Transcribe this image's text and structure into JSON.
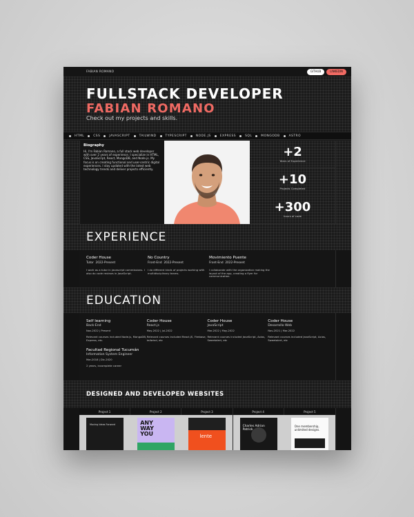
{
  "topbar": {
    "brand": "FABIAN ROMANO",
    "github_label": "GITHUB",
    "linkedin_label": "LINKEDIN"
  },
  "hero": {
    "title": "FULLSTACK DEVELOPER",
    "name": "FABIAN ROMANO",
    "subtitle": "Check out my projects and skills."
  },
  "tech": [
    "HTML",
    "CSS",
    "JAVASCRIPT",
    "TAILWIND",
    "TYPESCRIPT",
    "NODE.JS",
    "EXPRESS",
    "SQL",
    "MONGODB",
    "ASTRO"
  ],
  "bio": {
    "heading": "Biography",
    "text": "Hi, I'm Fabian Romano, a full stack web developer with over 2 years of experience. I specialize in HTML, CSS, JavaScript, React, MongoDB, and Node.js. My focus is on creating functional and user-centric digital experiences. I stay updated with the latest web technology trends and deliver projects efficiently."
  },
  "stats": [
    {
      "value": "+2",
      "label": "Years of Experience"
    },
    {
      "value": "+10",
      "label": "Projects Completed"
    },
    {
      "value": "+300",
      "label": "hours of code"
    }
  ],
  "experience": {
    "title": "EXPERIENCE",
    "items": [
      {
        "company": "Coder House",
        "role": "Tutor",
        "period": "2022-Present",
        "desc": "I work as a tutor in javascript commissions. I also do code reviews in JavaScript."
      },
      {
        "company": "No Country",
        "role": "Front-End",
        "period": "2022-Present",
        "desc": "I do different kinds of projects working with multidisciplinary teams."
      },
      {
        "company": "Movimiento Puente",
        "role": "Front-End",
        "period": "2022-Present",
        "desc": "I collaborate with the organization making the layout of the app, creating a flyer for communication."
      }
    ]
  },
  "education": {
    "title": "EDUCATION",
    "items": [
      {
        "school": "Self learning",
        "degree": "Back-End",
        "dates": "Nov-2022 | Present",
        "related": "Relevant courses included Node.js, MongoDB, Express, etc."
      },
      {
        "school": "Coder House",
        "degree": "React.js",
        "dates": "May-2022 | Jul-2022",
        "related": "Relevant courses included React.JS, Firebase, tailwind, etc"
      },
      {
        "school": "Coder House",
        "degree": "JavaScript",
        "dates": "Mar-2022 | May-2022",
        "related": "Relevant courses included JavaScript, Axios, Sweetalert, etc"
      },
      {
        "school": "Coder House",
        "degree": "Desarrollo Web",
        "dates": "Nov-2021 | Mar-2022",
        "related": "Relevant courses included JavaScript, Axios, Sweetalert, etc"
      },
      {
        "school": "Facultad Regional Tucumán",
        "degree": "Information System Engineer",
        "dates": "Mar-2018 | Dic-2020",
        "related": "2 years, incomplete career"
      }
    ]
  },
  "projects": {
    "title": "DESIGNED AND DEVELOPED WEBSITES",
    "items": [
      {
        "label": "Project 1",
        "thumb_text": "Moving Ideas Forward"
      },
      {
        "label": "Project 2",
        "thumb_text": "ANY WAY YOU"
      },
      {
        "label": "Project 3",
        "thumb_text": "lente"
      },
      {
        "label": "Project 4",
        "thumb_text": "Charles Adrian Patrick"
      },
      {
        "label": "Project 5",
        "thumb_text": "One membership, unlimited designs."
      }
    ]
  },
  "colors": {
    "accent": "#f06a63",
    "background": "#141414",
    "text": "#ffffff"
  }
}
